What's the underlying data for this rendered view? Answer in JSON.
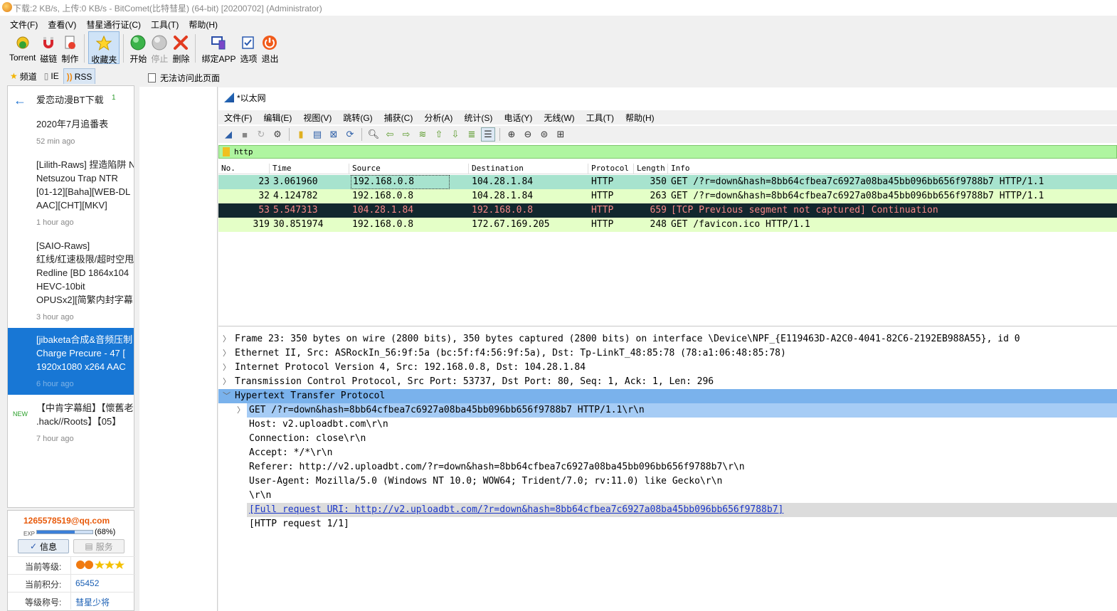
{
  "window": {
    "title": "下载:2 KB/s, 上传:0 KB/s - BitComet(比特彗星) (64-bit) [20200702] (Administrator)"
  },
  "menu": [
    "文件(F)",
    "查看(V)",
    "彗星通行证(C)",
    "工具(T)",
    "帮助(H)"
  ],
  "toolbar": {
    "torrent": "Torrent",
    "magnet": "磁链",
    "make": "制作",
    "favorites": "收藏夹",
    "start": "开始",
    "stop": "停止",
    "delete": "删除",
    "bind_app": "绑定APP",
    "options": "选项",
    "exit": "退出"
  },
  "left_tabs": [
    "频道",
    "IE",
    "RSS"
  ],
  "rss": {
    "channel_title": "爱恋动漫BT下载",
    "channel_count": "1",
    "items": [
      {
        "lines": [
          "2020年7月追番表"
        ],
        "time": "52 min ago"
      },
      {
        "lines": [
          "[Lilith-Raws] 捏造陷阱 N",
          "Netsuzou Trap NTR",
          "[01-12][Baha][WEB-DL",
          "AAC][CHT][MKV]"
        ],
        "time": "1 hour ago"
      },
      {
        "lines": [
          "[SAIO-Raws]",
          "红线/红速极限/超时空甩",
          "Redline [BD 1864x104",
          "HEVC-10bit",
          "OPUSx2][简繁内封字幕"
        ],
        "time": "3 hour ago"
      },
      {
        "lines": [
          "[jibaketa合成&音频压制",
          "Charge Precure - 47 [",
          "1920x1080 x264 AAC"
        ],
        "time": "6 hour ago"
      },
      {
        "badge": "NEW",
        "lines": [
          "【中肯字幕組】【懷舊老",
          ".hack//Roots】【05】"
        ],
        "time": "7 hour ago"
      }
    ]
  },
  "user": {
    "email": "1265578519@qq.com",
    "exp_label": "EXP",
    "exp_pct_text": "(68%)",
    "exp_fraction": 0.68,
    "tab_info": "信息",
    "tab_service": "服务",
    "level_label": "当前等级:",
    "score_label": "当前积分:",
    "score_value": "65452",
    "title_label": "等级称号:",
    "title_value": "彗星少将"
  },
  "content": {
    "page_title": "无法访问此页面"
  },
  "ws": {
    "title": "*以太网",
    "menu": [
      "文件(F)",
      "编辑(E)",
      "视图(V)",
      "跳转(G)",
      "捕获(C)",
      "分析(A)",
      "统计(S)",
      "电话(Y)",
      "无线(W)",
      "工具(T)",
      "帮助(H)"
    ],
    "filter": "http",
    "columns": [
      "No.",
      "Time",
      "Source",
      "Destination",
      "Protocol",
      "Length",
      "Info"
    ],
    "packets": [
      {
        "no": "23",
        "time": "3.061960",
        "src": "192.168.0.8",
        "dst": "104.28.1.84",
        "proto": "HTTP",
        "len": "350",
        "info": "GET /?r=down&hash=8bb64cfbea7c6927a08ba45bb096bb656f9788b7 HTTP/1.1"
      },
      {
        "no": "32",
        "time": "4.124782",
        "src": "192.168.0.8",
        "dst": "104.28.1.84",
        "proto": "HTTP",
        "len": "263",
        "info": "GET /?r=down&hash=8bb64cfbea7c6927a08ba45bb096bb656f9788b7 HTTP/1.1"
      },
      {
        "no": "53",
        "time": "5.547313",
        "src": "104.28.1.84",
        "dst": "192.168.0.8",
        "proto": "HTTP",
        "len": "659",
        "info": "[TCP Previous segment not captured] Continuation"
      },
      {
        "no": "319",
        "time": "30.851974",
        "src": "192.168.0.8",
        "dst": "172.67.169.205",
        "proto": "HTTP",
        "len": "248",
        "info": "GET /favicon.ico HTTP/1.1"
      }
    ],
    "details": [
      "Frame 23: 350 bytes on wire (2800 bits), 350 bytes captured (2800 bits) on interface \\Device\\NPF_{E119463D-A2C0-4041-82C6-2192EB988A55}, id 0",
      "Ethernet II, Src: ASRockIn_56:9f:5a (bc:5f:f4:56:9f:5a), Dst: Tp-LinkT_48:85:78 (78:a1:06:48:85:78)",
      "Internet Protocol Version 4, Src: 192.168.0.8, Dst: 104.28.1.84",
      "Transmission Control Protocol, Src Port: 53737, Dst Port: 80, Seq: 1, Ack: 1, Len: 296",
      "Hypertext Transfer Protocol",
      "GET /?r=down&hash=8bb64cfbea7c6927a08ba45bb096bb656f9788b7 HTTP/1.1\\r\\n",
      "Host: v2.uploadbt.com\\r\\n",
      "Connection: close\\r\\n",
      "Accept: */*\\r\\n",
      "Referer: http://v2.uploadbt.com/?r=down&hash=8bb64cfbea7c6927a08ba45bb096bb656f9788b7\\r\\n",
      "User-Agent: Mozilla/5.0 (Windows NT 10.0; WOW64; Trident/7.0; rv:11.0) like Gecko\\r\\n",
      "\\r\\n",
      "[Full request URI: http://v2.uploadbt.com/?r=down&hash=8bb64cfbea7c6927a08ba45bb096bb656f9788b7]",
      "[HTTP request 1/1]"
    ]
  },
  "colors": {
    "accent": "#1877d5",
    "filter_bg": "#aff5a0",
    "row_green": "#e4ffc7",
    "row_dark": "#12272e",
    "email": "#e85a0a"
  }
}
